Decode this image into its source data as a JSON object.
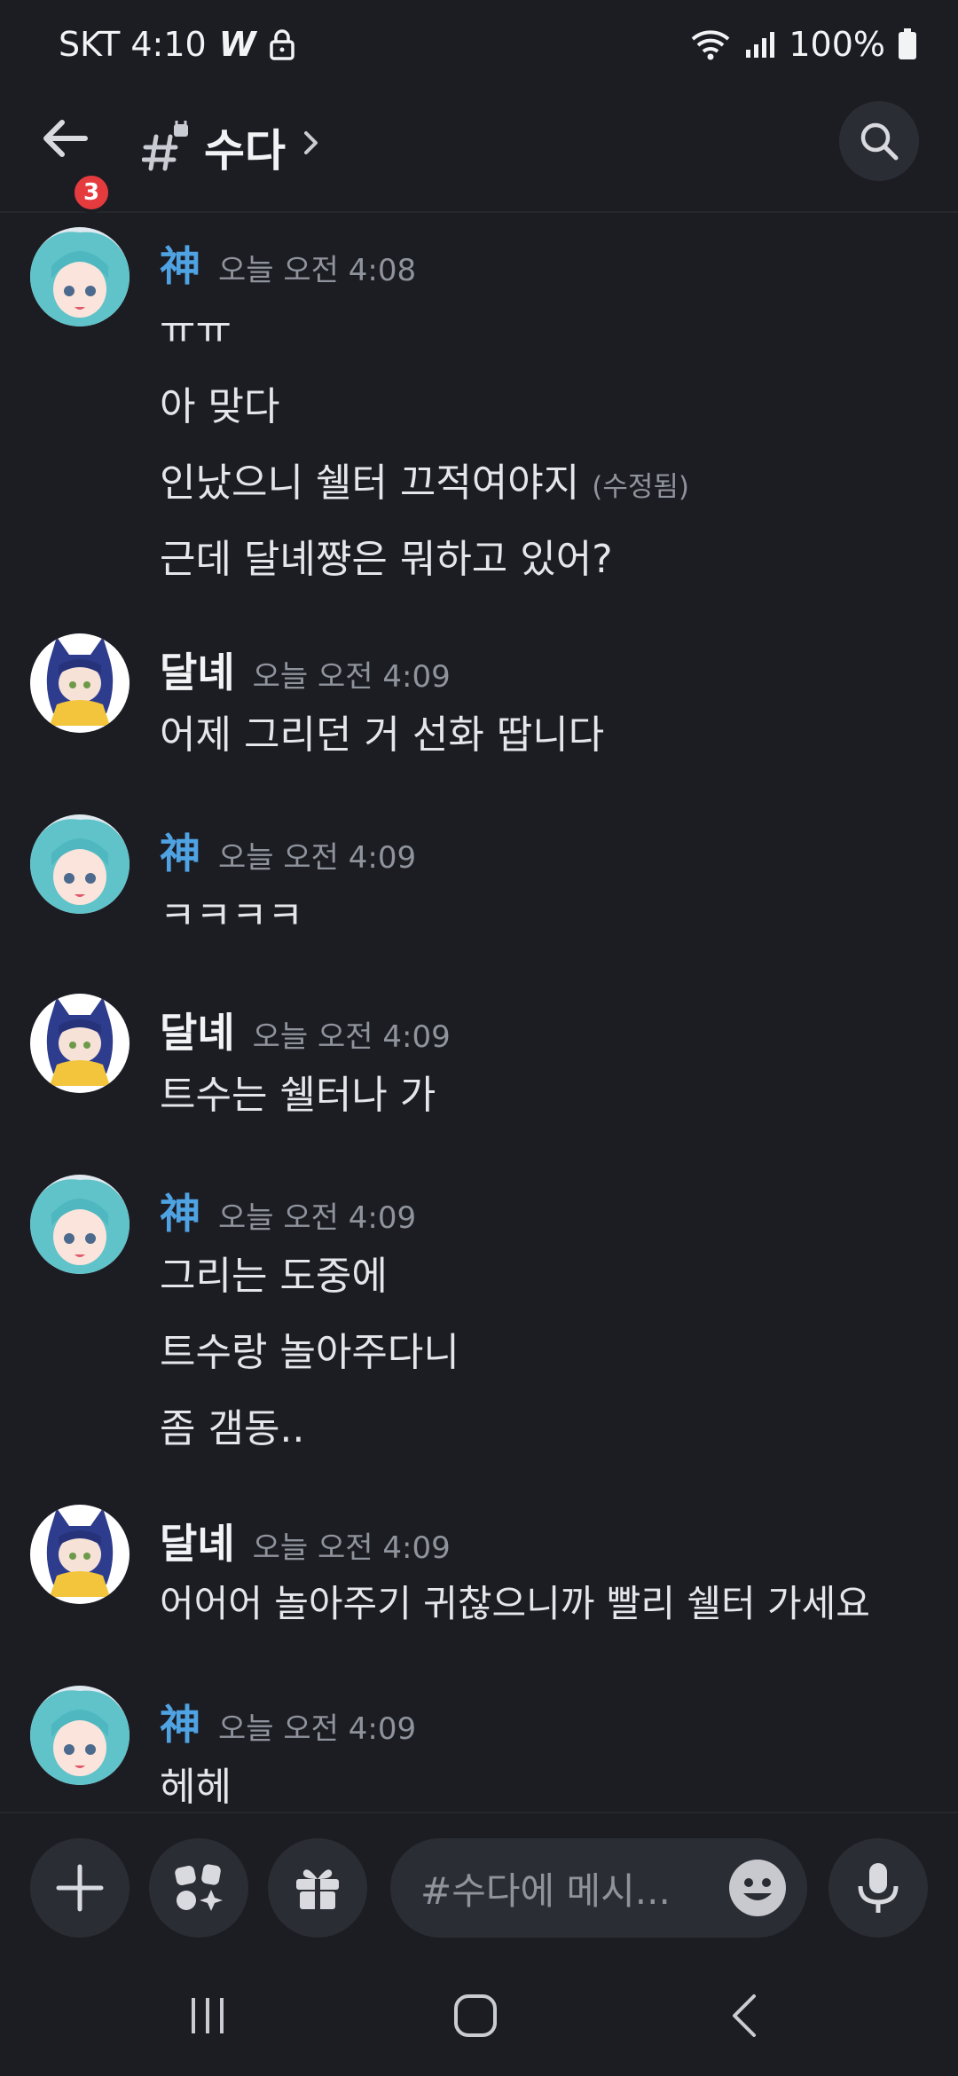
{
  "status_bar": {
    "carrier_time": "SKT 4:10",
    "w_label": "W",
    "battery": "100%"
  },
  "header": {
    "back_badge": "3",
    "channel_name": "수다"
  },
  "messages": [
    {
      "author": "神",
      "time": "오늘 오전 4:08",
      "lines": [
        "ㅠㅠ",
        "아 맞다",
        "인났으니 쉘터 끄적여야지",
        "근데 달녜쨩은 뭐하고 있어?"
      ],
      "edited_label": "(수정됨)"
    },
    {
      "author": "달녜",
      "time": "오늘 오전 4:09",
      "lines": [
        "어제 그리던 거 선화 땁니다"
      ]
    },
    {
      "author": "神",
      "time": "오늘 오전 4:09",
      "lines": [
        "ㅋㅋㅋㅋ"
      ]
    },
    {
      "author": "달녜",
      "time": "오늘 오전 4:09",
      "lines": [
        "트수는 쉘터나 가"
      ]
    },
    {
      "author": "神",
      "time": "오늘 오전 4:09",
      "lines": [
        "그리는 도중에",
        "트수랑 놀아주다니",
        "좀 갬동.."
      ]
    },
    {
      "author": "달녜",
      "time": "오늘 오전 4:09",
      "lines": [
        "어어어 놀아주기 귀찮으니까 빨리 쉘터 가세요"
      ]
    },
    {
      "author": "神",
      "time": "오늘 오전 4:09",
      "lines": [
        "헤헤"
      ]
    }
  ],
  "composer": {
    "placeholder": "#수다에 메시..."
  },
  "colors": {
    "background": "#1c1d23",
    "accent_blue": "#4fa3e3",
    "badge_red": "#e53b3f"
  },
  "icons": [
    "back-arrow-icon",
    "channel-hash-icon",
    "search-icon",
    "plus-icon",
    "apps-icon",
    "gift-icon",
    "emoji-icon",
    "microphone-icon",
    "wifi-icon",
    "signal-icon",
    "battery-icon",
    "lock-icon"
  ]
}
